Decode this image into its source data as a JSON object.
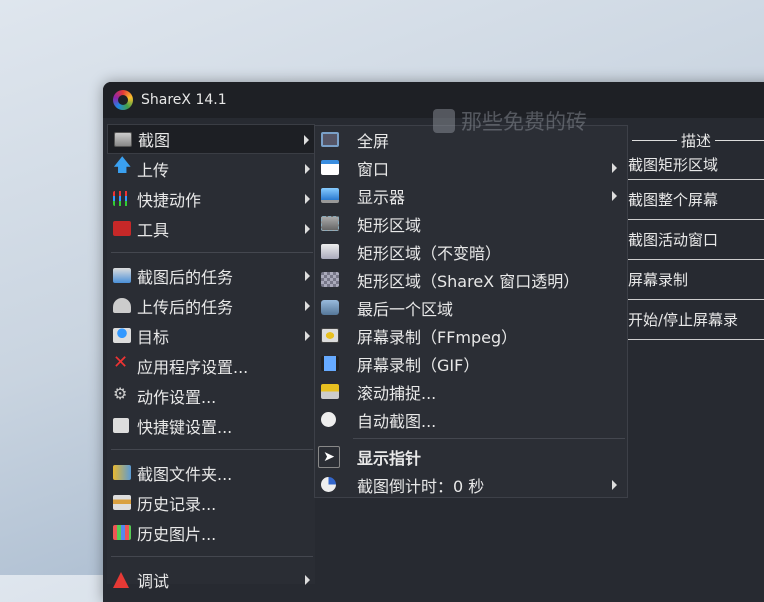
{
  "window": {
    "title": "ShareX 14.1"
  },
  "watermark": "那些免费的砖",
  "main_menu": {
    "items": [
      {
        "label": "截图",
        "icon": "camera-icon",
        "submenu": true
      },
      {
        "label": "上传",
        "icon": "upload-arrow-icon",
        "submenu": true
      },
      {
        "label": "快捷动作",
        "icon": "grid-icon",
        "submenu": true
      },
      {
        "label": "工具",
        "icon": "toolbox-icon",
        "submenu": true
      },
      {
        "label": "截图后的任务",
        "icon": "after-capture-icon",
        "submenu": true
      },
      {
        "label": "上传后的任务",
        "icon": "cloud-icon",
        "submenu": true
      },
      {
        "label": "目标",
        "icon": "destination-icon",
        "submenu": true
      },
      {
        "label": "应用程序设置...",
        "icon": "wrench-icon",
        "submenu": false
      },
      {
        "label": "动作设置...",
        "icon": "gear-icon",
        "submenu": false
      },
      {
        "label": "快捷键设置...",
        "icon": "keyboard-icon",
        "submenu": false
      },
      {
        "label": "截图文件夹...",
        "icon": "folder-icon",
        "submenu": false
      },
      {
        "label": "历史记录...",
        "icon": "history-icon",
        "submenu": false
      },
      {
        "label": "历史图片...",
        "icon": "image-history-icon",
        "submenu": false
      },
      {
        "label": "调试",
        "icon": "cone-icon",
        "submenu": true
      }
    ]
  },
  "capture_submenu": {
    "items": [
      {
        "label": "全屏",
        "icon": "fullscreen-icon"
      },
      {
        "label": "窗口",
        "icon": "window-icon"
      },
      {
        "label": "显示器",
        "icon": "monitor-icon"
      },
      {
        "label": "矩形区域",
        "icon": "rectangle-icon"
      },
      {
        "label": "矩形区域（不变暗）",
        "icon": "rectangle-light-icon"
      },
      {
        "label": "矩形区域（ShareX 窗口透明）",
        "icon": "rectangle-transparent-icon"
      },
      {
        "label": "最后一个区域",
        "icon": "last-region-icon"
      },
      {
        "label": "屏幕录制（FFmpeg）",
        "icon": "screen-record-icon"
      },
      {
        "label": "屏幕录制（GIF）",
        "icon": "film-icon"
      },
      {
        "label": "滚动捕捉...",
        "icon": "scroll-capture-icon"
      },
      {
        "label": "自动截图...",
        "icon": "clock-icon"
      },
      {
        "label": "显示指针",
        "icon": "cursor-icon"
      },
      {
        "label": "截图倒计时：0 秒",
        "icon": "timer-icon"
      }
    ]
  },
  "description_panel": {
    "header": "描述",
    "rows": [
      "截图矩形区域",
      "截图整个屏幕",
      "截图活动窗口",
      "屏幕录制",
      "开始/停止屏幕录"
    ]
  }
}
